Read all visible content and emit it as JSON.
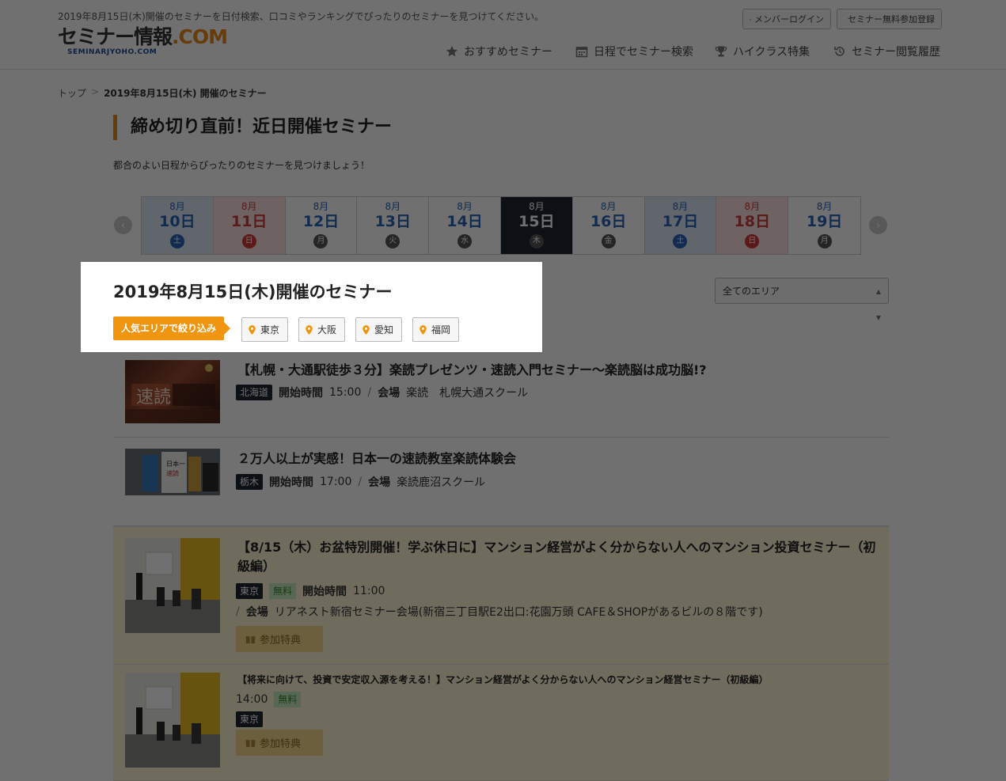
{
  "header": {
    "tagline": "2019年8月15日(木)開催のセミナーを日付検索、口コミやランキングでぴったりのセミナーを見つけてください。",
    "logo_main": "セミナー情報",
    "logo_com": ".COM",
    "logo_sub": "SEMINARJYOHO.COM",
    "login_label": "メンバーログイン",
    "register_label": "セミナー無料参加登録",
    "nav": [
      {
        "label": "おすすめセミナー",
        "icon": "star-icon"
      },
      {
        "label": "日程でセミナー検索",
        "icon": "calendar-icon"
      },
      {
        "label": "ハイクラス特集",
        "icon": "trophy-icon"
      },
      {
        "label": "セミナー閲覧履歴",
        "icon": "history-icon"
      }
    ]
  },
  "breadcrumb": {
    "home": "トップ",
    "sep": ">",
    "current": "2019年8月15日(木) 開催のセミナー"
  },
  "page": {
    "title": "締め切り直前！近日開催セミナー",
    "lead": "都合のよい日程からぴったりのセミナーを見つけましょう！"
  },
  "calendar": {
    "prev": "‹",
    "next": "›",
    "days": [
      {
        "month": "8月",
        "day": "10日",
        "weekday": "土",
        "type": "sat"
      },
      {
        "month": "8月",
        "day": "11日",
        "weekday": "日",
        "type": "sun"
      },
      {
        "month": "8月",
        "day": "12日",
        "weekday": "月",
        "type": "wk"
      },
      {
        "month": "8月",
        "day": "13日",
        "weekday": "火",
        "type": "wk"
      },
      {
        "month": "8月",
        "day": "14日",
        "weekday": "水",
        "type": "wk"
      },
      {
        "month": "8月",
        "day": "15日",
        "weekday": "木",
        "type": "sel"
      },
      {
        "month": "8月",
        "day": "16日",
        "weekday": "金",
        "type": "wk"
      },
      {
        "month": "8月",
        "day": "17日",
        "weekday": "土",
        "type": "sat"
      },
      {
        "month": "8月",
        "day": "18日",
        "weekday": "日",
        "type": "sun"
      },
      {
        "month": "8月",
        "day": "19日",
        "weekday": "月",
        "type": "wk"
      }
    ]
  },
  "section": {
    "title": "2019年8月15日(木)開催のセミナー",
    "filter_label": "人気エリアで絞り込み",
    "areas": [
      "東京",
      "大阪",
      "愛知",
      "福岡"
    ],
    "area_select": "全てのエリア"
  },
  "seminars": [
    {
      "title": "【札幌・大通駅徒歩３分】楽読プレゼンツ・速読入門セミナー〜楽読脳は成功脳!?",
      "pref": "北海道",
      "start_label": "開始時間",
      "start": "15:00",
      "venue_label": "会場",
      "venue": "楽読　札幌大通スクール"
    },
    {
      "title": "２万人以上が実感！日本一の速読教室楽読体験会",
      "pref": "栃木",
      "start_label": "開始時間",
      "start": "17:00",
      "venue_label": "会場",
      "venue": "楽読鹿沼スクール"
    },
    {
      "title": "【8/15（木）お盆特別開催！学ぶ休日に】マンション経営がよく分からない人へのマンション投資セミナー（初級編）",
      "pref": "東京",
      "free": "無料",
      "start_label": "開始時間",
      "start": "11:00",
      "venue_label": "会場",
      "venue": "リアネスト新宿セミナー会場(新宿三丁目駅E2出口:花園万頭 CAFE＆SHOPがあるビルの８階です)",
      "perk": "参加特典"
    },
    {
      "title": "【将来に向けて、投資で安定収入源を考える！】マンション経営がよく分からない人へのマンション経営セミナー（初級編）",
      "time": "14:00",
      "free": "無料",
      "pref": "東京",
      "perk": "参加特典"
    }
  ]
}
